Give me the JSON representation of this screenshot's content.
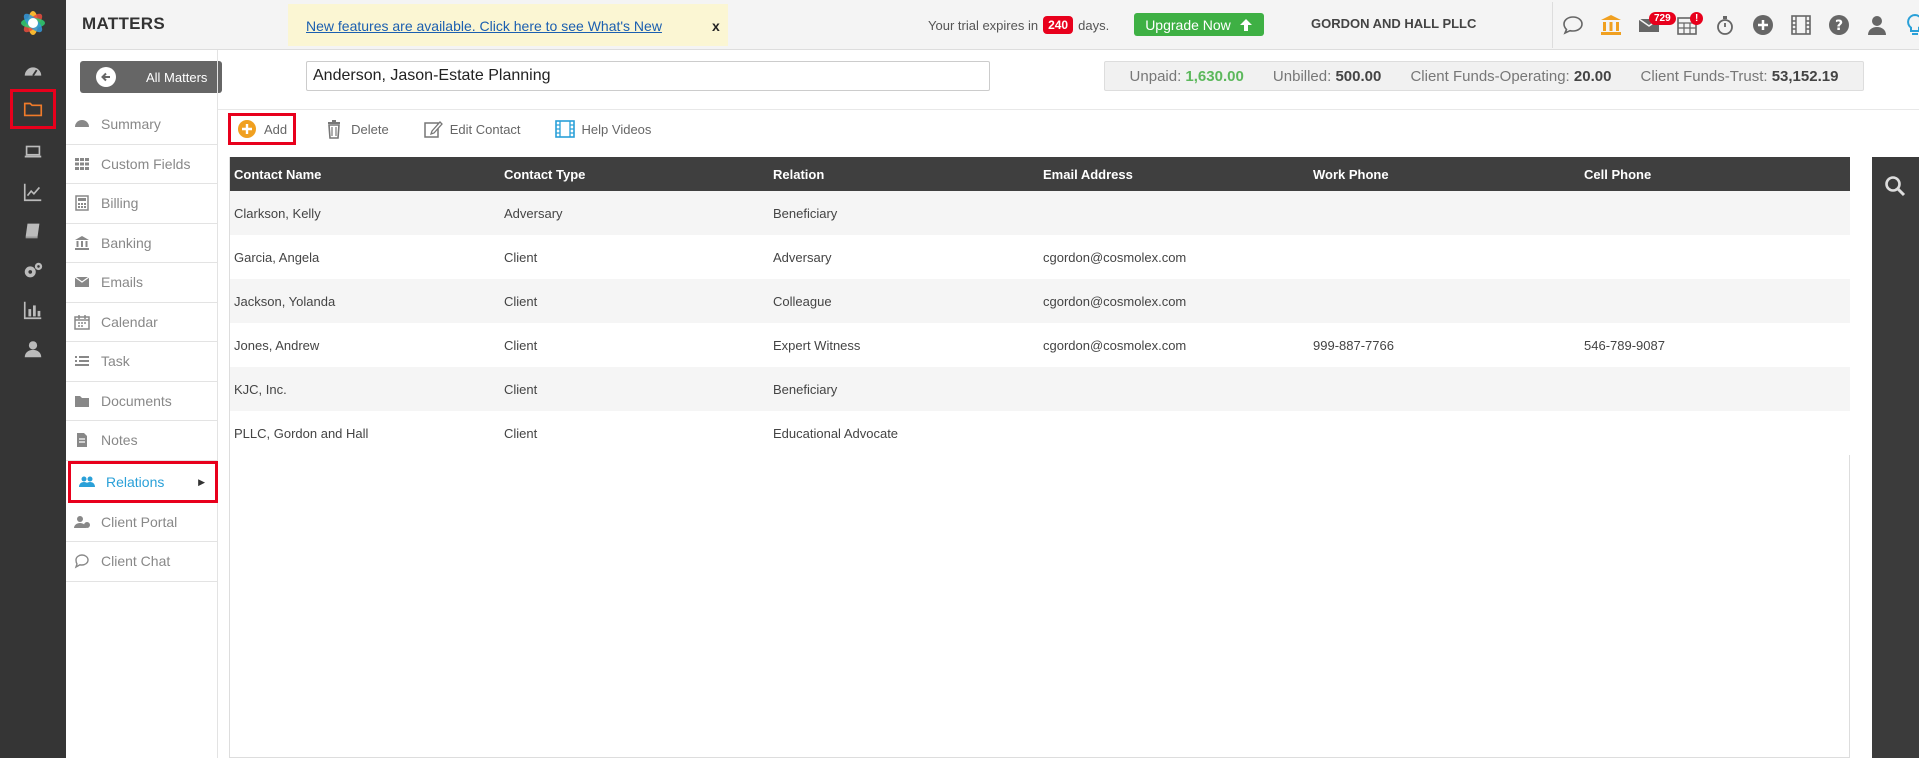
{
  "header": {
    "title": "MATTERS",
    "banner_link": "New features are available. Click here to see What's New",
    "banner_close": "x",
    "trial_prefix": "Your trial expires in",
    "trial_days": "240",
    "trial_suffix": "days.",
    "upgrade_label": "Upgrade Now",
    "firm_name": "GORDON AND HALL PLLC",
    "mail_count": "729",
    "calendar_alert": "!"
  },
  "matter": {
    "all_matters_label": "All Matters",
    "name": "Anderson, Jason-Estate Planning"
  },
  "funds": {
    "unpaid_label": "Unpaid:",
    "unpaid_value": "1,630.00",
    "unbilled_label": "Unbilled:",
    "unbilled_value": "500.00",
    "operating_label": "Client Funds-Operating:",
    "operating_value": "20.00",
    "trust_label": "Client Funds-Trust:",
    "trust_value": "53,152.19"
  },
  "sections": [
    {
      "label": "Summary",
      "icon": "dashboard-icon"
    },
    {
      "label": "Custom Fields",
      "icon": "grid-icon"
    },
    {
      "label": "Billing",
      "icon": "calculator-icon"
    },
    {
      "label": "Banking",
      "icon": "bank-icon"
    },
    {
      "label": "Emails",
      "icon": "envelope-icon"
    },
    {
      "label": "Calendar",
      "icon": "calendar-icon"
    },
    {
      "label": "Task",
      "icon": "task-icon"
    },
    {
      "label": "Documents",
      "icon": "folder-icon"
    },
    {
      "label": "Notes",
      "icon": "note-icon"
    },
    {
      "label": "Relations",
      "icon": "users-icon"
    },
    {
      "label": "Client Portal",
      "icon": "portal-icon"
    },
    {
      "label": "Client Chat",
      "icon": "chat-icon"
    }
  ],
  "toolbar": {
    "add_label": "Add",
    "delete_label": "Delete",
    "edit_label": "Edit Contact",
    "help_label": "Help Videos"
  },
  "table": {
    "columns": [
      "Contact Name",
      "Contact Type",
      "Relation",
      "Email Address",
      "Work Phone",
      "Cell Phone"
    ],
    "rows": [
      [
        "Clarkson, Kelly",
        "Adversary",
        "Beneficiary",
        "",
        "",
        ""
      ],
      [
        "Garcia, Angela",
        "Client",
        "Adversary",
        "cgordon@cosmolex.com",
        "",
        ""
      ],
      [
        "Jackson, Yolanda",
        "Client",
        "Colleague",
        "cgordon@cosmolex.com",
        "",
        ""
      ],
      [
        "Jones, Andrew",
        "Client",
        "Expert Witness",
        "cgordon@cosmolex.com",
        "999-887-7766",
        "546-789-9087"
      ],
      [
        "KJC, Inc.",
        "Client",
        "Beneficiary",
        "",
        "",
        ""
      ],
      [
        "PLLC, Gordon and Hall",
        "Client",
        "Educational Advocate",
        "",
        "",
        ""
      ]
    ]
  },
  "colors": {
    "rail": "#353535",
    "highlight": "#e8001c",
    "accent_blue": "#2aa0d8",
    "upgrade_green": "#3eb044",
    "table_header": "#3f3f3f"
  }
}
